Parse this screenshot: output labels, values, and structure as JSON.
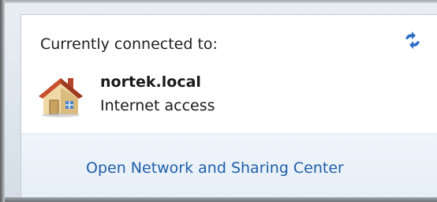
{
  "popup": {
    "connected_label": "Currently connected to:",
    "refresh_icon": "refresh-arrows-icon"
  },
  "network": {
    "icon": "home-network-icon",
    "name": "nortek.local",
    "status": "Internet access"
  },
  "footer": {
    "link_label": "Open Network and Sharing Center"
  },
  "colors": {
    "link": "#1f5fa8",
    "footer_bg": "#eef4fa",
    "text": "#1e1e1e"
  }
}
